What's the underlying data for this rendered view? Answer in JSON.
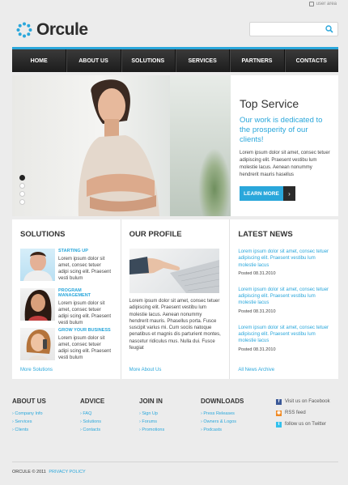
{
  "header": {
    "user_area": "user area",
    "logo": "Orcule",
    "search_placeholder": ""
  },
  "nav": [
    "HOME",
    "ABOUT US",
    "SOLUTIONS",
    "SERVICES",
    "PARTNERS",
    "CONTACTS"
  ],
  "hero": {
    "title": "Top Service",
    "subtitle": "Our work is dedicated to the prosperity of our clients!",
    "body": "Lorem ipsum dolor sit amet, consec tetuer adipiscing elit. Praesent vestibu lum molestie lacus. Aenean nonummy hendrerit mauris hasellus",
    "button": "LEARN MORE",
    "slides": 4,
    "active_slide": 1
  },
  "solutions": {
    "heading": "SOLUTIONS",
    "items": [
      {
        "title": "STARTING UP",
        "text": "Lorem ipsum dolor sit amet, consec tetuer adipi scing elit. Praesent vesti bulum"
      },
      {
        "title": "PROGRAM MANAGEMENT",
        "text": "Lorem ipsum dolor sit amet, consec tetuer adipi scing elit. Praesent vesti bulum"
      },
      {
        "title": "GROW YOUR BUSINESS",
        "text": "Lorem ipsum dolor sit amet, consec tetuer adipi scing elit. Praesent vesti bulum"
      }
    ],
    "more": "More Solutions"
  },
  "profile": {
    "heading": "OUR PROFILE",
    "text": "Lorem ipsum dolor sit amet, consec tetuer adipiscing elit. Praesent vestibu lum molestie lacus. Aenean nonummy hendrerit mauris. Phasellus porta. Fusce suscipit varius mi. Cum sociis natoque penatibus et magnis dis parturient montes, nascetur ridiculus mus. Nulla dui. Fusce feugiat",
    "more": "More About Us"
  },
  "news": {
    "heading": "LATEST NEWS",
    "items": [
      {
        "text": "Lorem ipsum dolor sit amet, consec tetuer adipiscing elit. Praesent vestibu lum molestie lacus",
        "date": "Posted 08.31.2010"
      },
      {
        "text": "Lorem ipsum dolor sit amet, consec tetuer adipiscing elit. Praesent vestibu lum molestie lacus",
        "date": "Posted 08.31.2010"
      },
      {
        "text": "Lorem ipsum dolor sit amet, consec tetuer adipiscing elit. Praesent vestibu lum molestie lacus",
        "date": "Posted 08.31.2010"
      }
    ],
    "more": "All News Archive"
  },
  "footer": {
    "about": {
      "heading": "ABOUT US",
      "links": [
        "Company Info",
        "Services",
        "Clients"
      ]
    },
    "advice": {
      "heading": "ADVICE",
      "links": [
        "FAQ",
        "Solutions",
        "Contacts"
      ]
    },
    "join": {
      "heading": "JOIN IN",
      "links": [
        "Sign Up",
        "Forums",
        "Promotions"
      ]
    },
    "downloads": {
      "heading": "DOWNLOADS",
      "links": [
        "Press Releases",
        "Owners & Logos",
        "Podcasts"
      ]
    },
    "social": [
      "Visit us on Facebook",
      "RSS feed",
      "follow us on Twitter"
    ],
    "copyright": "ORCULE © 2011",
    "privacy": "PRIVACY POLICY"
  },
  "colors": {
    "accent": "#2aa7db",
    "nav_bg": "#2a2a2a",
    "page_bg": "#ececec"
  }
}
